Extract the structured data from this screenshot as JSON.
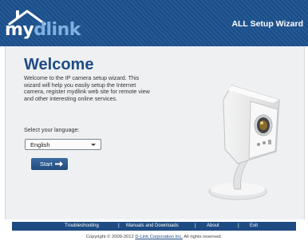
{
  "header": {
    "logo_prefix": "my",
    "logo_suffix": "dlink",
    "wizard_title": "ALL Setup Wizard"
  },
  "main": {
    "title": "Welcome",
    "description": "Welcome to the IP camera setup wizard. This wizard will help you easily setup the Internet camera, register mydlink web site for remote view and other interesting online services.",
    "language_label": "Select your language:",
    "language_value": "English",
    "start_label": "Start"
  },
  "footer": {
    "links": [
      "Troubleshooting",
      "Manuals and Downloads",
      "About",
      "Exit"
    ],
    "copyright_prefix": "Copyright © 2009-2012",
    "copyright_link": "D-Link Corporation Inc.",
    "copyright_suffix": "All rights reserved."
  },
  "colors": {
    "header_blue": "#1c4d86",
    "title_blue": "#1d4c84",
    "button_blue": "#2a5890"
  },
  "icons": {
    "logo": "house-roof-logo-icon",
    "start_arrow": "arrow-right-icon",
    "dropdown": "chevron-down-icon"
  }
}
